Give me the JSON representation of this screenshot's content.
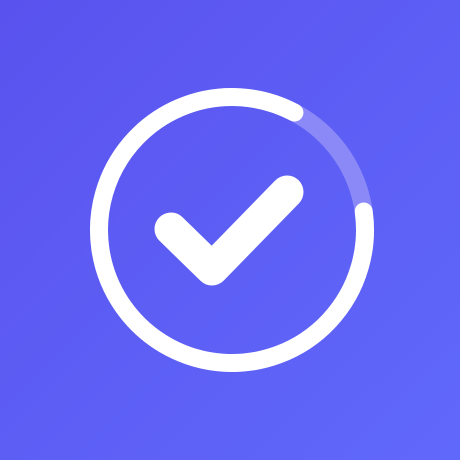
{
  "app_icon": {
    "name": "task-progress-check",
    "icon": "checkmark-in-progress-ring-icon",
    "progress_fraction": 0.85,
    "colors": {
      "background": "#5d5ff5",
      "ring": "#ffffff",
      "ring_track": "#8b89f7",
      "checkmark": "#ffffff"
    }
  }
}
